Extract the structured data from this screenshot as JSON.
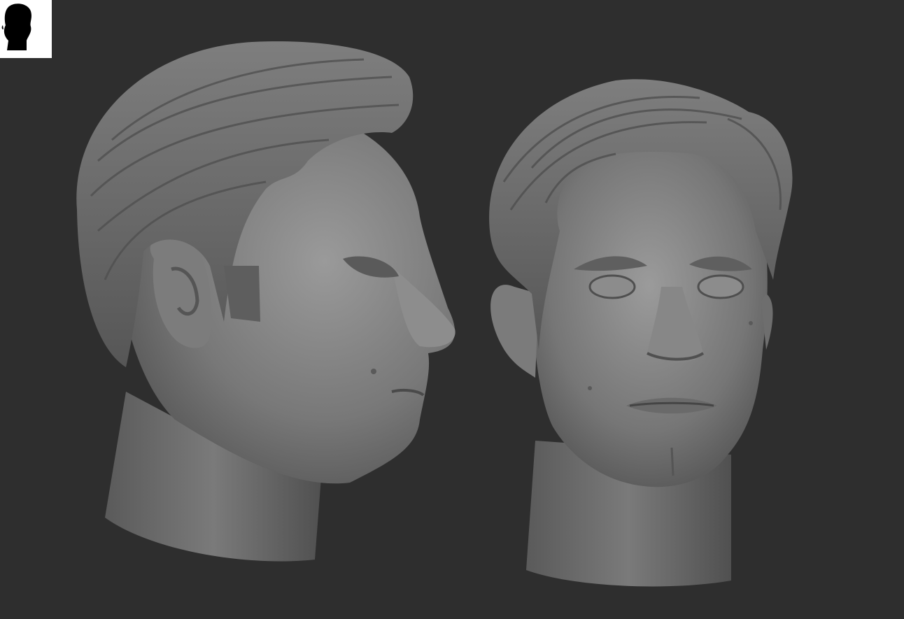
{
  "app": {
    "view": "3d-viewport",
    "background_color": "#2e2e2e",
    "material_color": "#8a8a8a"
  },
  "thumbnail": {
    "icon": "head-silhouette-icon",
    "background_color": "#ffffff",
    "silhouette_color": "#000000"
  },
  "models": [
    {
      "name": "head-profile-view",
      "icon": "sculpted-head-icon"
    },
    {
      "name": "head-front-view",
      "icon": "sculpted-head-icon"
    }
  ]
}
